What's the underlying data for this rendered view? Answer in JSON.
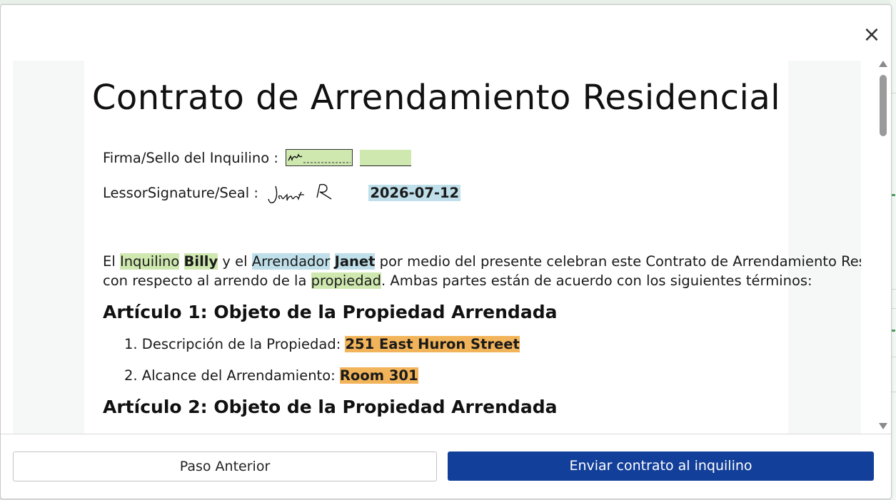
{
  "dialog": {
    "close_icon": "×"
  },
  "document": {
    "title": "Contrato de Arrendamiento Residencial",
    "tenant_sig_label": "Firma/Sello del Inquilino :",
    "lessor_sig_label": "LessorSignature/Seal :",
    "lessor_date": "2026-07-12",
    "intro": {
      "p1": "El ",
      "w_inquilino": "Inquilino",
      "tenant_name": "Billy",
      "p2": " y el ",
      "w_arrendador": "Arrendador",
      "lessor_name": "Janet",
      "p3": " por medio del presente celebran este ",
      "p4": "Contrato de Arrendamiento Residencial",
      "p5": "con respecto al arrendo de la ",
      "w_propiedad": "propiedad",
      "p6": ". Ambas partes están de acuerdo con los siguientes términos:"
    },
    "article1": {
      "heading": "Artículo 1: Objeto de la Propiedad Arrendada",
      "item1_label": "1. Descripción de la Propiedad: ",
      "item1_value": "251 East Huron Street",
      "item2_label": "2. Alcance del Arrendamiento: ",
      "item2_value": "Room 301"
    },
    "article2": {
      "heading": "Artículo 2: Objeto de la Propiedad Arrendada"
    }
  },
  "footer": {
    "prev_label": "Paso Anterior",
    "send_label": "Enviar contrato al inquilino"
  },
  "colors": {
    "primary_button": "#123f9a",
    "highlight_green": "#cfe8b0",
    "highlight_blue": "#bfe0ea",
    "highlight_orange": "#f2b45a"
  }
}
